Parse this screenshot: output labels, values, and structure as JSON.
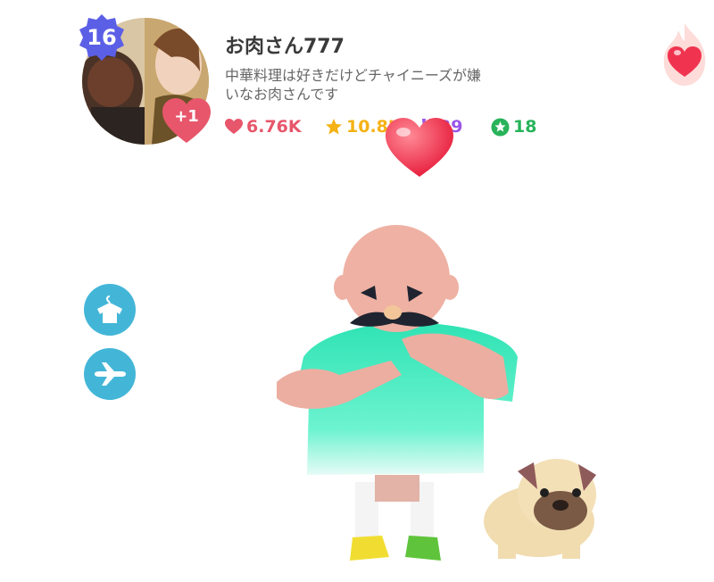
{
  "profile": {
    "level": "16",
    "gain_badge": "+1",
    "username": "お肉さん777",
    "bio_line1": "中華料理は好きだけどチャイニーズが嫌",
    "bio_line2": "いなお肉さんです"
  },
  "stats": {
    "likes": "6.76K",
    "stars": "10.8K",
    "gems": "39",
    "badges": "18"
  },
  "colors": {
    "like_red": "#e7566b",
    "star_yellow": "#f4b214",
    "gem_purple": "#9a55e8",
    "badge_green": "#28b35a",
    "button_blue": "#43b6d8",
    "level_badge": "#5b5fe6"
  },
  "icons": {
    "likes": "heart-icon",
    "stars": "star-icon",
    "gems": "exclamation-gem-icon",
    "badges": "star-circle-icon",
    "outfit_button": "hanger-shirt-icon",
    "travel_button": "airplane-icon"
  }
}
